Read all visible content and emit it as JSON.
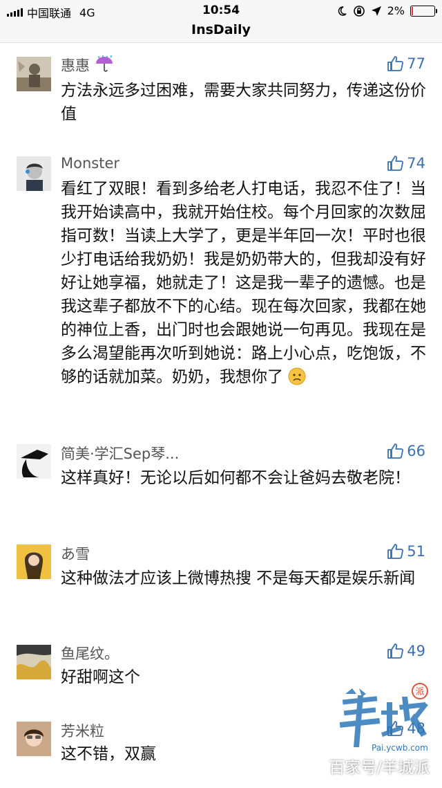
{
  "status_bar": {
    "carrier": "中国联通",
    "network": "4G",
    "time": "10:54",
    "battery": "2%"
  },
  "nav": {
    "title": "InsDaily"
  },
  "comments": [
    {
      "author": "惠惠",
      "likes": "77",
      "text": "方法永远多过困难，需要大家共同努力，传递这份价值"
    },
    {
      "author": "Monster",
      "likes": "74",
      "text": "看红了双眼！看到多给老人打电话，我忍不住了！当我开始读高中，我就开始住校。每个月回家的次数屈指可数！当读上大学了，更是半年回一次！平时也很少打电话给我奶奶！我是奶奶带大的，但我却没有好好让她享福，她就走了！这是我一辈子的遗憾。也是我这辈子都放不下的心结。现在每次回家，我都在她的神位上香，出门时也会跟她说一句再见。我现在是多么渴望能再次听到她说：路上小心点，吃饱饭，不够的话就加菜。奶奶，我想你了"
    },
    {
      "author": "简美·学汇Sep琴...",
      "likes": "66",
      "text": "这样真好！无论以后如何都不会让爸妈去敬老院！"
    },
    {
      "author": "あ雪",
      "likes": "51",
      "text": "这种做法才应该上微博热搜  不是每天都是娱乐新闻"
    },
    {
      "author": "鱼尾纹。",
      "likes": "49",
      "text": "好甜啊这个"
    },
    {
      "author": "芳米粒",
      "likes": "48",
      "text": "这不错，双赢"
    }
  ],
  "watermark": {
    "logo_text": "羊城",
    "logo_badge": "派",
    "url": "Pai.ycwb.com",
    "caption": "百家号/羊城派"
  },
  "colors": {
    "accent": "#3a6fb0",
    "author": "#555555",
    "logo": "#2e78b8"
  }
}
